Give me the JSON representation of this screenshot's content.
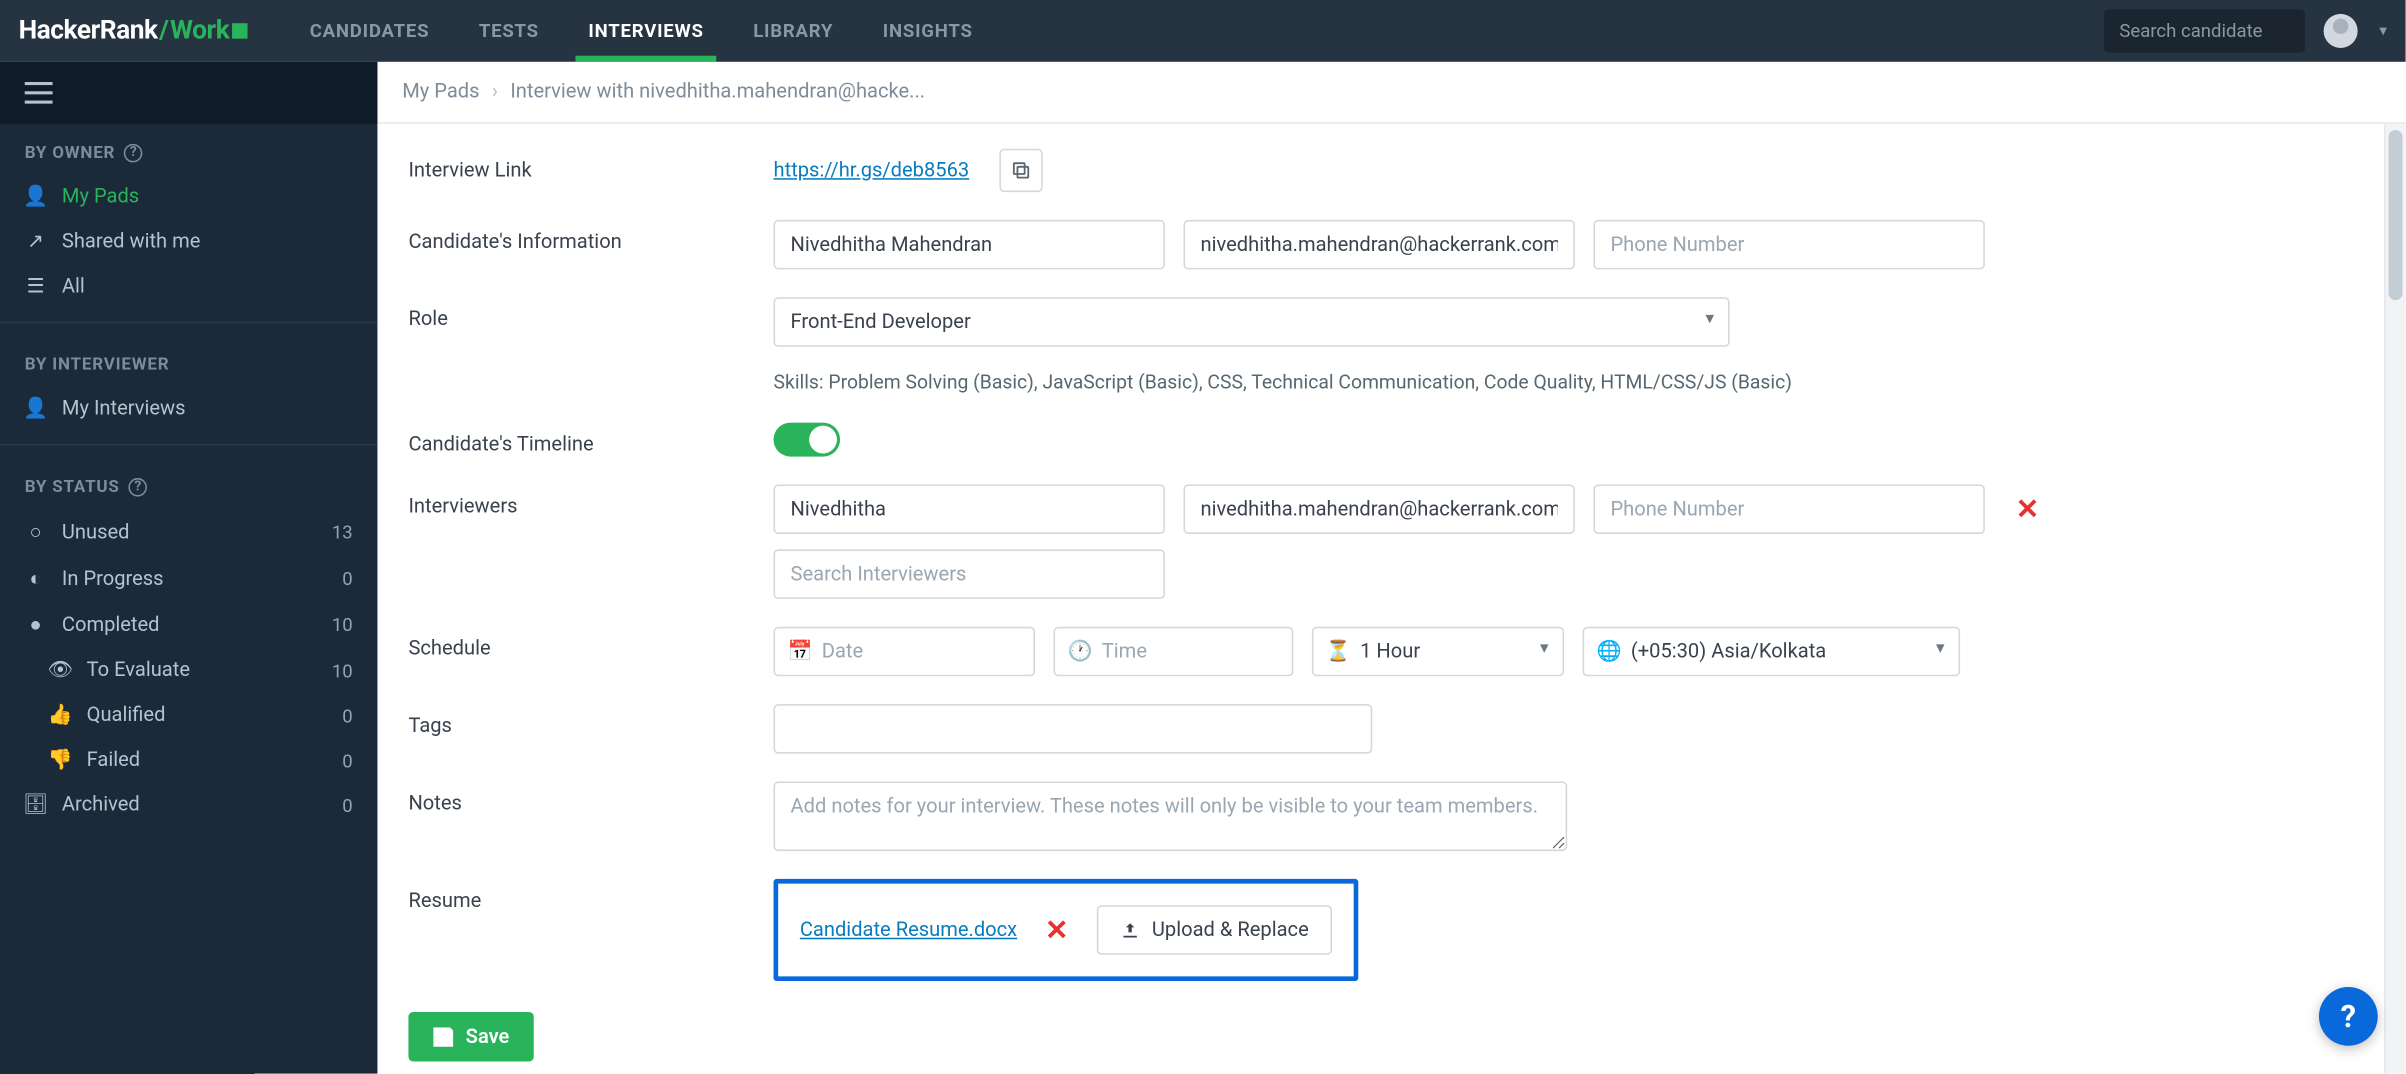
{
  "brand": {
    "hacker": "HackerRank",
    "work": "Work"
  },
  "nav": {
    "candidates": "CANDIDATES",
    "tests": "TESTS",
    "interviews": "INTERVIEWS",
    "library": "LIBRARY",
    "insights": "INSIGHTS"
  },
  "search_placeholder": "Search candidate",
  "sidebar": {
    "by_owner": "BY OWNER",
    "my_pads": "My Pads",
    "shared": "Shared with me",
    "all": "All",
    "by_interviewer": "BY INTERVIEWER",
    "my_interviews": "My Interviews",
    "by_status": "BY STATUS",
    "unused": {
      "label": "Unused",
      "count": "13"
    },
    "inprogress": {
      "label": "In Progress",
      "count": "0"
    },
    "completed": {
      "label": "Completed",
      "count": "10"
    },
    "toeval": {
      "label": "To Evaluate",
      "count": "10"
    },
    "qualified": {
      "label": "Qualified",
      "count": "0"
    },
    "failed": {
      "label": "Failed",
      "count": "0"
    },
    "archived": {
      "label": "Archived",
      "count": "0"
    }
  },
  "breadcrumb": {
    "root": "My Pads",
    "current": "Interview with nivedhitha.mahendran@hacke..."
  },
  "form": {
    "interview_link": {
      "label": "Interview Link",
      "url": "https://hr.gs/deb8563"
    },
    "candidate_info": {
      "label": "Candidate's Information",
      "name": "Nivedhitha Mahendran",
      "email": "nivedhitha.mahendran@hackerrank.com",
      "phone_ph": "Phone Number"
    },
    "role": {
      "label": "Role",
      "value": "Front-End Developer",
      "skills": "Skills: Problem Solving (Basic), JavaScript (Basic), CSS, Technical Communication, Code Quality, HTML/CSS/JS (Basic)"
    },
    "timeline": {
      "label": "Candidate's Timeline"
    },
    "interviewers": {
      "label": "Interviewers",
      "name": "Nivedhitha",
      "email": "nivedhitha.mahendran@hackerrank.com",
      "phone_ph": "Phone Number",
      "search_ph": "Search Interviewers"
    },
    "schedule": {
      "label": "Schedule",
      "date_ph": "Date",
      "time_ph": "Time",
      "duration": "1 Hour",
      "tz": "(+05:30) Asia/Kolkata"
    },
    "tags": {
      "label": "Tags"
    },
    "notes": {
      "label": "Notes",
      "ph": "Add notes for your interview. These notes will only be visible to your team members."
    },
    "resume": {
      "label": "Resume",
      "filename": "Candidate Resume.docx",
      "upload": "Upload & Replace"
    },
    "save": "Save"
  }
}
